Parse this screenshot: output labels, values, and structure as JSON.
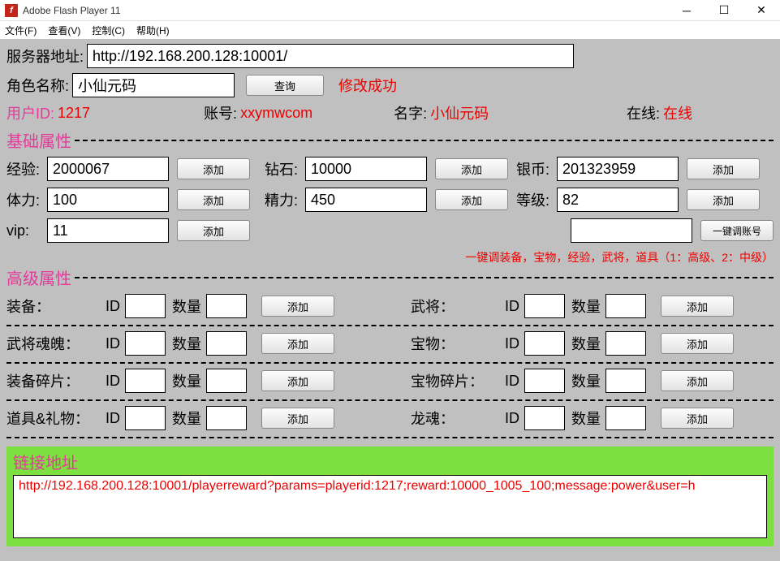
{
  "window": {
    "title": "Adobe Flash Player 11",
    "icon_letter": "f"
  },
  "menu": {
    "file": "文件(F)",
    "view": "查看(V)",
    "control": "控制(C)",
    "help": "帮助(H)"
  },
  "server": {
    "label": "服务器地址:",
    "value": "http://192.168.200.128:10001/"
  },
  "role": {
    "label": "角色名称:",
    "value": "小仙元码",
    "query_btn": "查询",
    "status": "修改成功"
  },
  "user": {
    "id_label": "用户ID:",
    "id_value": "1217",
    "account_label": "账号:",
    "account_value": "xxymwcom",
    "name_label": "名字:",
    "name_value": "小仙元码",
    "online_label": "在线:",
    "online_value": "在线"
  },
  "sections": {
    "basic": "基础属性",
    "advanced": "高级属性",
    "link": "链接地址"
  },
  "basic": {
    "exp_label": "经验:",
    "exp_value": "2000067",
    "diamond_label": "钻石:",
    "diamond_value": "10000",
    "silver_label": "银币:",
    "silver_value": "201323959",
    "stamina_label": "体力:",
    "stamina_value": "100",
    "energy_label": "精力:",
    "energy_value": "450",
    "level_label": "等级:",
    "level_value": "82",
    "vip_label": "vip:",
    "vip_value": "11",
    "add_btn": "添加",
    "reset_btn": "一键调账号",
    "hint": "一键调装备，宝物，经验，武将，道具（1：高级、2：中级）"
  },
  "advanced": {
    "id_label": "ID",
    "qty_label": "数量",
    "add_btn": "添加",
    "rows": [
      {
        "left": "装备：",
        "right": "武将："
      },
      {
        "left": "武将魂魄：",
        "right": "宝物："
      },
      {
        "left": "装备碎片：",
        "right": "宝物碎片："
      },
      {
        "left": "道具&礼物：",
        "right": "龙魂："
      }
    ]
  },
  "link": {
    "url": "http://192.168.200.128:10001/playerreward?params=playerid:1217;reward:10000_1005_100;message:power&user=h"
  }
}
